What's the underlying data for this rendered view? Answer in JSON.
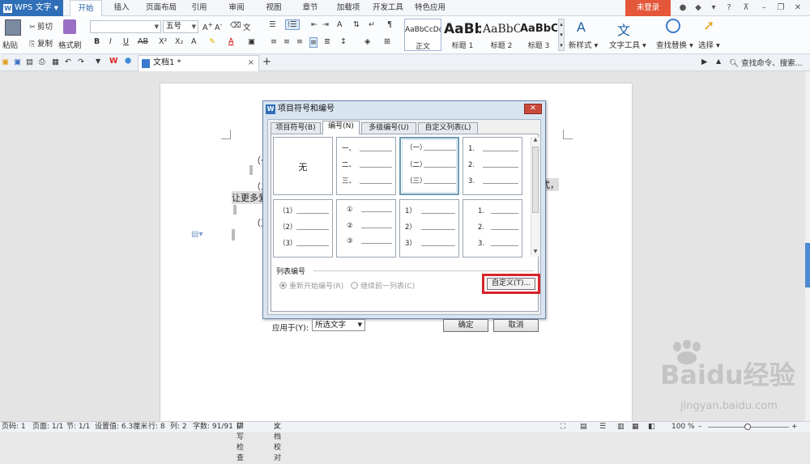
{
  "app": {
    "name": "WPS 文字",
    "login_label": "未登录"
  },
  "menu_tabs": [
    "开始",
    "插入",
    "页面布局",
    "引用",
    "审阅",
    "视图",
    "章节",
    "加载项",
    "开发工具",
    "特色应用"
  ],
  "ribbon": {
    "paste": "粘贴",
    "cut": "剪切",
    "copy": "复制",
    "format_painter": "格式刷",
    "font_size": "五号",
    "styles": [
      {
        "sample": "AaBbCcDd",
        "name": "正文"
      },
      {
        "sample": "AaBb",
        "name": "标题 1"
      },
      {
        "sample": "AaBbC",
        "name": "标题 2"
      },
      {
        "sample": "AaBbC",
        "name": "标题 3"
      }
    ],
    "new_style": "新样式",
    "text_tools": "文字工具",
    "find_replace": "查找替换",
    "select": "选择"
  },
  "doc_tab": {
    "title": "文档1 *",
    "close": "×",
    "add": "+"
  },
  "search_placeholder": "查找命令、搜索...",
  "document": {
    "lines": [
      "（一",
      "（二",
      "让更多爱",
      "（三",
      "式，"
    ]
  },
  "dialog": {
    "title": "项目符号和编号",
    "tabs": [
      "项目符号(B)",
      "编号(N)",
      "多级编号(U)",
      "自定义列表(L)"
    ],
    "cells": [
      {
        "none": "无"
      },
      {
        "items": [
          "一、",
          "二、",
          "三、"
        ]
      },
      {
        "items": [
          "（一）",
          "（二）",
          "（三）"
        ],
        "selected": true
      },
      {
        "items": [
          "1.",
          "2.",
          "3."
        ]
      },
      {
        "items": [
          "（1）",
          "（2）",
          "（3）"
        ]
      },
      {
        "items": [
          "①",
          "②",
          "③"
        ]
      },
      {
        "items": [
          "1）",
          "2）",
          "3）"
        ]
      },
      {
        "items": [
          "1.",
          "2.",
          "3."
        ]
      }
    ],
    "list_numbering_label": "列表编号",
    "radio_restart": "重新开始编号(R)",
    "radio_continue": "继续前一列表(C)",
    "custom_button": "自定义(T)...",
    "apply_to_label": "应用于(Y):",
    "apply_to_value": "所选文字",
    "ok": "确定",
    "cancel": "取消"
  },
  "status": {
    "page": "页码: 1",
    "pages": "页面: 1/1",
    "section": "节: 1/1",
    "setting": "设置值: 6.3厘米",
    "row": "行: 8",
    "col": "列: 2",
    "words": "字数: 91/91",
    "spell": "拼写检查",
    "proof": "文档校对",
    "zoom": "100 %"
  },
  "watermark": {
    "brand": "Baidu经验",
    "url": "jingyan.baidu.com"
  },
  "colors": {
    "accent": "#2f6fb8",
    "login": "#e4573a",
    "highlight": "#d7242a"
  }
}
